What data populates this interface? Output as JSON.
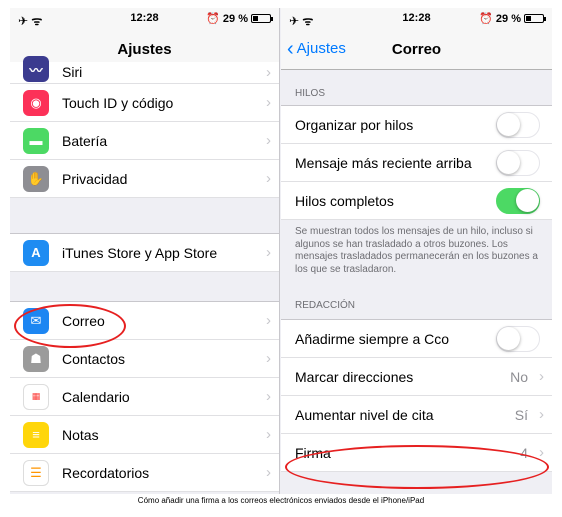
{
  "status_left": "✈ ᯤ",
  "status_time": "12:28",
  "status_battery": "29 %",
  "battery_level": 0.29,
  "left_panel": {
    "title": "Ajustes",
    "items_top": [
      {
        "label": "Siri",
        "icon": "siri-icon",
        "color": "#3b3b8f"
      },
      {
        "label": "Touch ID y código",
        "icon": "fingerprint-icon",
        "color": "#fc3158"
      },
      {
        "label": "Batería",
        "icon": "battery-icon",
        "color": "#4cd964"
      },
      {
        "label": "Privacidad",
        "icon": "hand-icon",
        "color": "#8e8e93"
      }
    ],
    "items_mid": [
      {
        "label": "iTunes Store y App Store",
        "icon": "app-store-icon",
        "color": "#1e8cf2"
      }
    ],
    "items_bottom": [
      {
        "label": "Correo",
        "icon": "mail-icon",
        "color": "#1d86f2"
      },
      {
        "label": "Contactos",
        "icon": "contacts-icon",
        "color": "#9b9b9b"
      },
      {
        "label": "Calendario",
        "icon": "calendar-icon",
        "color": "#ffffff"
      },
      {
        "label": "Notas",
        "icon": "notes-icon",
        "color": "#ffd60a"
      },
      {
        "label": "Recordatorios",
        "icon": "reminders-icon",
        "color": "#ffffff"
      }
    ]
  },
  "right_panel": {
    "back_label": "Ajustes",
    "title": "Correo",
    "section_threads": "HILOS",
    "threads": [
      {
        "label": "Organizar por hilos",
        "on": false
      },
      {
        "label": "Mensaje más reciente arriba",
        "on": false
      },
      {
        "label": "Hilos completos",
        "on": true
      }
    ],
    "threads_note": "Se muestran todos los mensajes de un hilo, incluso si algunos se han trasladado a otros buzones. Los mensajes trasladados permanecerán en los buzones a los que se trasladaron.",
    "section_compose": "REDACCIÓN",
    "compose_toggle": {
      "label": "Añadirme siempre a Cco",
      "on": false
    },
    "compose_items": [
      {
        "label": "Marcar direcciones",
        "value": "No"
      },
      {
        "label": "Aumentar nivel de cita",
        "value": "Sí"
      },
      {
        "label": "Firma",
        "value": "4"
      }
    ]
  },
  "caption": "Cómo añadir una firma a los correos electrónicos enviados desde el iPhone/iPad",
  "colors": {
    "accent": "#007aff",
    "toggle_on": "#4cd964",
    "highlight": "#e62020"
  }
}
